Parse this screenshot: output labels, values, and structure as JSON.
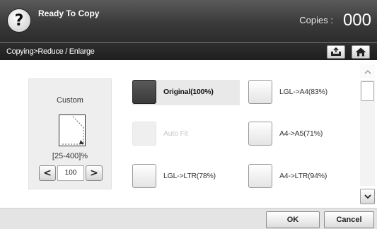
{
  "header": {
    "help_icon": "question-mark-icon",
    "help_glyph": "?",
    "title": "Ready To Copy",
    "copies_label": "Copies :",
    "copies_value": "000"
  },
  "breadcrumb": {
    "text": "Copying>Reduce / Enlarge",
    "icons": [
      "tray-upload-icon",
      "home-icon"
    ]
  },
  "custom": {
    "title": "Custom",
    "range": "[25-400]%",
    "decrement": "<",
    "value": "100",
    "increment": ">"
  },
  "options": {
    "original": "Original(100%)",
    "auto_fit": "Auto Fit",
    "lgl_ltr": "LGL->LTR(78%)",
    "lgl_a4": "LGL->A4(83%)",
    "a4_a5": "A4->A5(71%)",
    "a4_ltr": "A4->LTR(94%)",
    "selected": "original",
    "disabled": [
      "auto_fit"
    ]
  },
  "scroll": {
    "up": "^",
    "down": "v"
  },
  "footer": {
    "ok": "OK",
    "cancel": "Cancel"
  },
  "colors": {
    "header_bg": "#3a3a3a",
    "selected_box": "#4a4a4a",
    "disabled_text": "#c8c8c8"
  }
}
